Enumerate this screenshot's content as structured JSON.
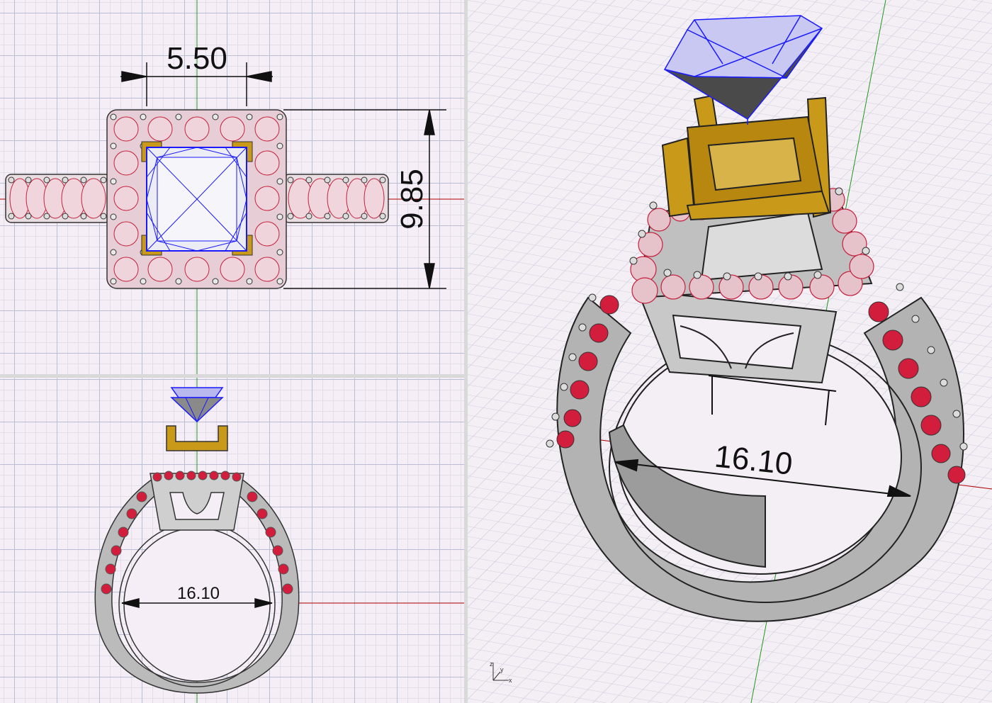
{
  "viewports": {
    "top": {
      "dimension_width": "5.50",
      "dimension_height": "9.85"
    },
    "front": {
      "dimension_ring": "16.10"
    },
    "perspective": {
      "dimension_ring": "16.10"
    }
  },
  "axes": {
    "z": "z",
    "y": "y",
    "x": "x"
  },
  "colors": {
    "grid_major": "#b9bed4",
    "grid_minor": "#e2dfea",
    "x_axis": "#b00000",
    "y_axis": "#1d9a1d",
    "gem_outline": "#1a1aff",
    "metal_gold": "#c99a1a",
    "metal_white": "#b9b9b9",
    "pave_red": "#d21e3c"
  }
}
